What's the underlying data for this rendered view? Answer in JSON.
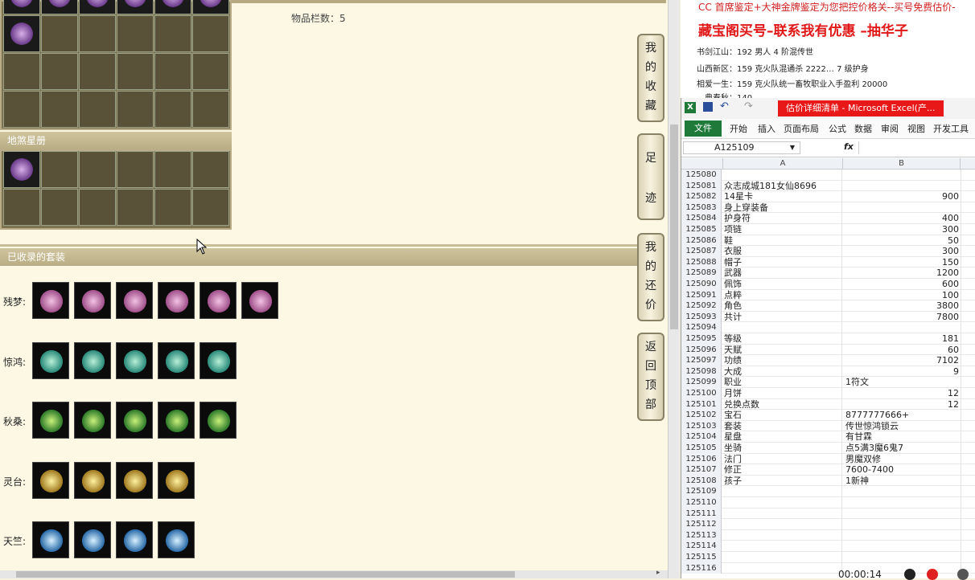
{
  "game": {
    "item_count_label": "物品栏数：5",
    "sections": {
      "disha": "地煞星册",
      "collected_sets": "已收录的套装"
    },
    "sets": [
      {
        "label": "残梦:",
        "count": 6,
        "color": "pink"
      },
      {
        "label": "惊鸿:",
        "count": 5,
        "color": "teal"
      },
      {
        "label": "秋桑:",
        "count": 5,
        "color": "green"
      },
      {
        "label": "灵台:",
        "count": 4,
        "color": "gold"
      },
      {
        "label": "天竺:",
        "count": 4,
        "color": "blue"
      }
    ],
    "side_buttons": [
      {
        "chars": [
          "我",
          "的",
          "收",
          "藏"
        ]
      },
      {
        "chars": [
          "足",
          "迹"
        ]
      },
      {
        "chars": [
          "我",
          "的",
          "还",
          "价"
        ]
      },
      {
        "chars": [
          "返",
          "回",
          "顶",
          "部"
        ]
      }
    ]
  },
  "ad": {
    "line1": "CC 首席鉴定+大神金牌鉴定为您把控价格关--买号免费估价-",
    "headline": "藏宝阁买号–联系我有优惠 –抽华子",
    "lines": [
      "书剑江山：192 男人 4 阶混传世",
      "山西新区：159 克火队混通杀 2222… 7 级护身",
      "相爱一生：159 克火队统一畜牧职业入手盈利 20000",
      "…典春秋：140 …"
    ]
  },
  "excel": {
    "title": "估价详细清单 - Microsoft Excel(产...",
    "tabs": [
      "文件",
      "开始",
      "插入",
      "页面布局",
      "公式",
      "数据",
      "审阅",
      "视图",
      "开发工具"
    ],
    "name_box": "A125109",
    "fx": "fx",
    "col_a": "A",
    "col_b": "B",
    "rows": [
      {
        "n": "125080",
        "a": "",
        "b": "",
        "t": "num"
      },
      {
        "n": "125081",
        "a": "众志成城181女仙8696",
        "b": "",
        "t": "num"
      },
      {
        "n": "125082",
        "a": "14星卡",
        "b": "900",
        "t": "num"
      },
      {
        "n": "125083",
        "a": "身上穿装备",
        "b": "",
        "t": "num"
      },
      {
        "n": "125084",
        "a": "护身符",
        "b": "400",
        "t": "num"
      },
      {
        "n": "125085",
        "a": "项链",
        "b": "300",
        "t": "num"
      },
      {
        "n": "125086",
        "a": "鞋",
        "b": "50",
        "t": "num"
      },
      {
        "n": "125087",
        "a": "衣服",
        "b": "300",
        "t": "num"
      },
      {
        "n": "125088",
        "a": "帽子",
        "b": "150",
        "t": "num"
      },
      {
        "n": "125089",
        "a": "武器",
        "b": "1200",
        "t": "num"
      },
      {
        "n": "125090",
        "a": "佩饰",
        "b": "600",
        "t": "num"
      },
      {
        "n": "125091",
        "a": "点粹",
        "b": "100",
        "t": "num"
      },
      {
        "n": "125092",
        "a": "角色",
        "b": "3800",
        "t": "num"
      },
      {
        "n": "125093",
        "a": "共计",
        "b": "7800",
        "t": "num"
      },
      {
        "n": "125094",
        "a": "",
        "b": "",
        "t": "num"
      },
      {
        "n": "125095",
        "a": "等级",
        "b": "181",
        "t": "num"
      },
      {
        "n": "125096",
        "a": "天赋",
        "b": "60",
        "t": "num"
      },
      {
        "n": "125097",
        "a": "功绩",
        "b": "7102",
        "t": "num"
      },
      {
        "n": "125098",
        "a": "大成",
        "b": "9",
        "t": "num"
      },
      {
        "n": "125099",
        "a": "职业",
        "b": "1符文",
        "t": "txt"
      },
      {
        "n": "125100",
        "a": "月饼",
        "b": "12",
        "t": "num"
      },
      {
        "n": "125101",
        "a": "兑换点数",
        "b": "12",
        "t": "num"
      },
      {
        "n": "125102",
        "a": "宝石",
        "b": "8777777666+",
        "t": "txt"
      },
      {
        "n": "125103",
        "a": "套装",
        "b": "传世惊鸿锁云",
        "t": "txt"
      },
      {
        "n": "125104",
        "a": "星盘",
        "b": "有甘霖",
        "t": "txt"
      },
      {
        "n": "125105",
        "a": "坐骑",
        "b": "点5满3魔6鬼7",
        "t": "txt"
      },
      {
        "n": "125106",
        "a": "法门",
        "b": "男魔双修",
        "t": "txt"
      },
      {
        "n": "125107",
        "a": "修正",
        "b": "7600-7400",
        "t": "txt"
      },
      {
        "n": "125108",
        "a": "孩子",
        "b": "1新神",
        "t": "txt"
      },
      {
        "n": "125109",
        "a": "",
        "b": "",
        "t": "num"
      },
      {
        "n": "125110",
        "a": "",
        "b": "",
        "t": "num"
      },
      {
        "n": "125111",
        "a": "",
        "b": "",
        "t": "num"
      },
      {
        "n": "125112",
        "a": "",
        "b": "",
        "t": "num"
      },
      {
        "n": "125113",
        "a": "",
        "b": "",
        "t": "num"
      },
      {
        "n": "125114",
        "a": "",
        "b": "",
        "t": "num"
      },
      {
        "n": "125115",
        "a": "",
        "b": "",
        "t": "num"
      },
      {
        "n": "125116",
        "a": "",
        "b": "",
        "t": "num"
      }
    ]
  },
  "recorder": {
    "time": "00:00:14"
  }
}
